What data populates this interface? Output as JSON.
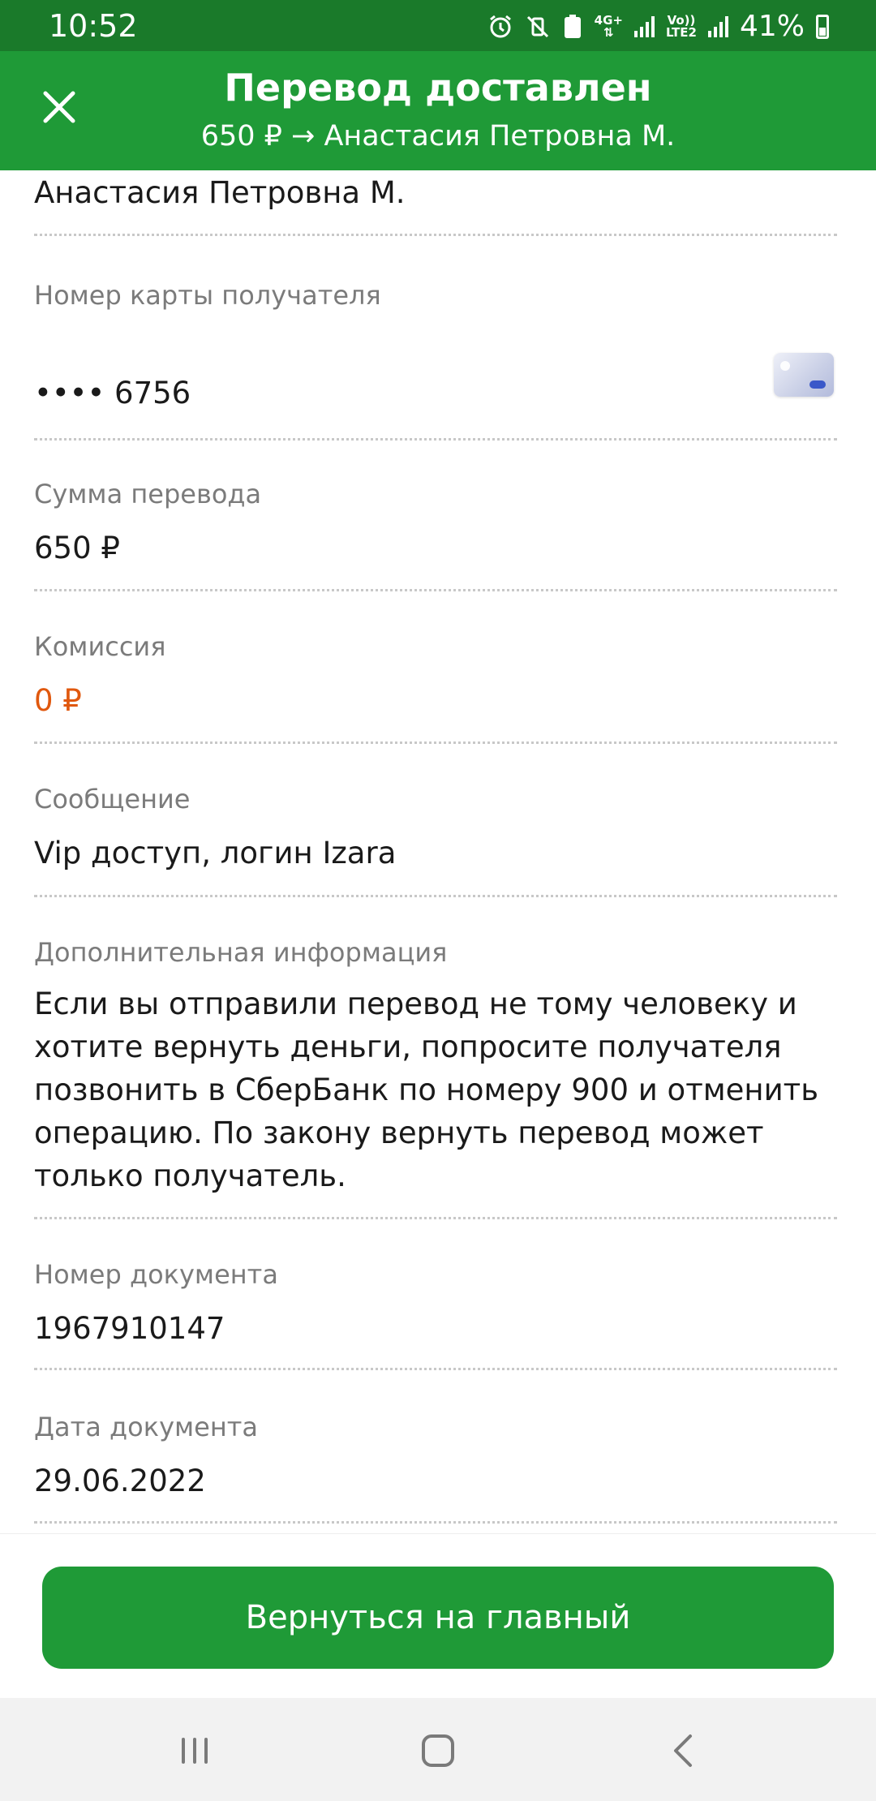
{
  "status_bar": {
    "time": "10:52",
    "network_4g": "4G+",
    "volte": "Vo))",
    "lte2": "LTE2",
    "battery": "41%"
  },
  "header": {
    "title": "Перевод доставлен",
    "subtitle": "650 ₽ → Анастасия Петровна М."
  },
  "details": {
    "recipient_name": "Анастасия Петровна М.",
    "card_label": "Номер карты получателя",
    "card_value": "•••• 6756",
    "amount_label": "Сумма перевода",
    "amount_value": "650 ₽",
    "fee_label": "Комиссия",
    "fee_value": "0 ₽",
    "message_label": "Сообщение",
    "message_value": "Vip доступ, логин Izara",
    "info_label": "Дополнительная информация",
    "info_value": "Если вы отправили перевод не тому человеку и хотите вернуть деньги, попросите получателя позвонить в СберБанк по номеру 900 и отменить операцию. По закону вернуть перевод может только получатель.",
    "doc_number_label": "Номер документа",
    "doc_number_value": "1967910147",
    "doc_date_label": "Дата документа",
    "doc_date_value": "29.06.2022"
  },
  "actions": {
    "home_button": "Вернуться на главный"
  },
  "colors": {
    "header_green": "#1f9a37",
    "status_green": "#1a7a2a",
    "fee_orange": "#e0580e"
  }
}
